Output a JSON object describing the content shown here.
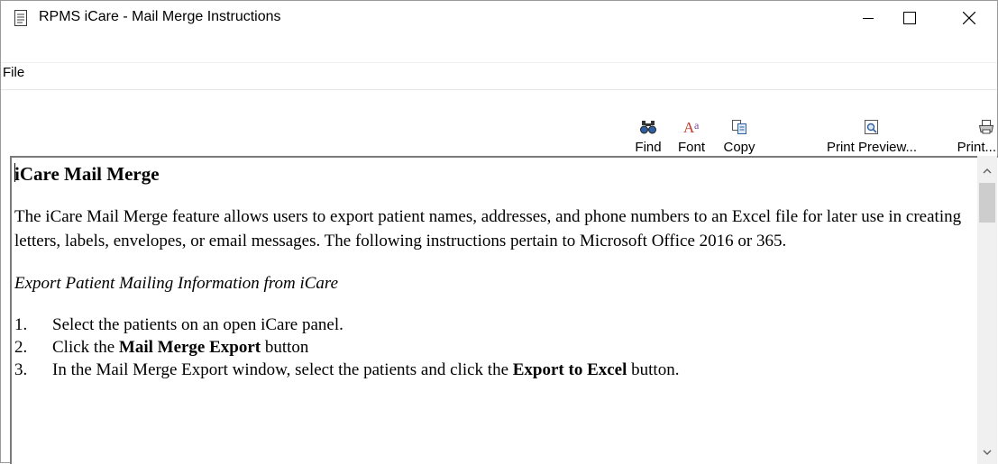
{
  "window": {
    "title": "RPMS iCare - Mail Merge Instructions",
    "icon": "document-icon",
    "controls": {
      "minimize": "minimize-icon",
      "maximize": "maximize-icon",
      "close": "close-icon"
    }
  },
  "menu": {
    "items": [
      {
        "label": "File"
      }
    ]
  },
  "toolbar": {
    "buttons": [
      {
        "label": "Find",
        "icon": "binoculars-icon"
      },
      {
        "label": "Font",
        "icon": "font-icon"
      },
      {
        "label": "Copy",
        "icon": "copy-icon"
      },
      {
        "label": "Print Preview...",
        "icon": "print-preview-icon"
      },
      {
        "label": "Print...",
        "icon": "printer-icon"
      }
    ]
  },
  "document": {
    "heading": "iCare Mail Merge",
    "intro": "The iCare Mail Merge feature allows users to export patient names, addresses, and phone numbers to an Excel file for later use in creating letters, labels, envelopes, or email messages. The following instructions pertain to Microsoft Office 2016 or 365.",
    "section_title": "Export Patient Mailing Information from iCare",
    "steps": [
      {
        "num": "1.",
        "text": "Select the patients on an open iCare panel."
      },
      {
        "num": "2.",
        "pre": "Click the ",
        "bold": "Mail Merge Export",
        "post": " button"
      },
      {
        "num": "3.",
        "pre": "In the Mail Merge Export window, select the patients and click the ",
        "bold": "Export to Excel",
        "post": " button."
      }
    ]
  },
  "colors": {
    "accent_red": "#c0392b",
    "icon_blue": "#2f5f9e",
    "scroll_track": "#f0f0f0",
    "scroll_thumb": "#cdcdcd"
  }
}
